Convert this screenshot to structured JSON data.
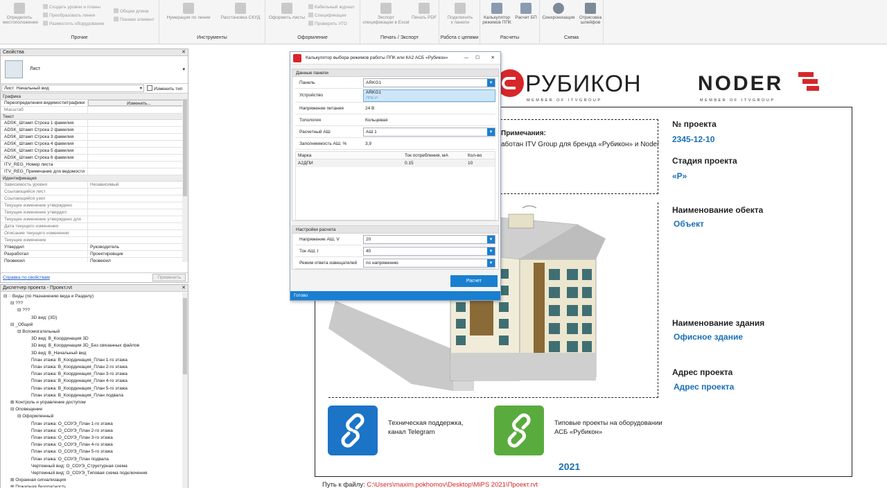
{
  "ribbon": {
    "groups": [
      {
        "label": "Прочие"
      },
      {
        "label": "Инструменты"
      },
      {
        "label": "Оформление"
      },
      {
        "label": "Печать / Экспорт"
      },
      {
        "label": "Работа с цепями"
      },
      {
        "label": "Расчеты"
      },
      {
        "label": "Схема"
      }
    ],
    "buttons": {
      "determine_location": "Определить\nместоположение",
      "create_levels": "Создать уровни и планы",
      "transform_lines": "Преобразовать линии",
      "place_equipment": "Разместить оборудование",
      "total_length": "Общая длина",
      "show_element": "Покажи элемент",
      "numbering": "Нумерация по линии",
      "skud": "Расстановка СКУД",
      "format_sheets": "Оформить листы",
      "cable_journal": "Кабельный журнал",
      "specification": "Спецификация",
      "check_ugo": "Проверить УГО",
      "export_spec": "Экспорт\nспецификации в Excel",
      "print_pdf": "Печать PDF",
      "connect_panels": "Подключить\nк панели",
      "calc_ppk": "Калькулятор\nрежимов ППК",
      "calc_bt": "Расчет БП",
      "sync": "Синхронизация",
      "draw_loops": "Отрисовка\nшлейфов"
    }
  },
  "properties": {
    "title": "Свойства",
    "type_name": "Лист",
    "instance": "Лист: Начальный вид",
    "edit_type": "Изменить тип",
    "sec_graphics": "Графика",
    "overrides_label": "Переопределения видимости/графики",
    "overrides_value": "Изменить...",
    "scale": "Масштаб",
    "sec_text": "Текст",
    "text_rows": [
      "ADSK_Штамп Строка 1 фамилия",
      "ADSK_Штамп Строка 2 фамилия",
      "ADSK_Штамп Строка 3 фамилия",
      "ADSK_Штамп Строка 4 фамилия",
      "ADSK_Штамп Строка 5 фамилия",
      "ADSK_Штамп Строка 6 фамилия",
      "ITV_REG_Номер листа",
      "ITV_REG_Примечание для ведомости"
    ],
    "sec_ident": "Идентификация",
    "ident_rows": [
      {
        "k": "Зависимость уровня",
        "v": "Независимый",
        "grey": true
      },
      {
        "k": "Ссылающийся лист",
        "v": "",
        "grey": true
      },
      {
        "k": "Ссылающийся узел",
        "v": "",
        "grey": true
      },
      {
        "k": "Текущее изменение утверждено",
        "v": "",
        "grey": true
      },
      {
        "k": "Текущее изменение утвердил",
        "v": "",
        "grey": true
      },
      {
        "k": "Текущее изменение утверждено для",
        "v": "",
        "grey": true
      },
      {
        "k": "Дата текущего изменения",
        "v": "",
        "grey": true
      },
      {
        "k": "Описание текущего изменения",
        "v": "",
        "grey": true
      },
      {
        "k": "Текущее изменение",
        "v": "",
        "grey": true
      },
      {
        "k": "Утвердил",
        "v": "Руководитель",
        "grey": false
      },
      {
        "k": "Разработал",
        "v": "Проектировщик",
        "grey": false
      },
      {
        "k": "Проверил",
        "v": "Проверил",
        "grey": false
      }
    ],
    "help_link": "Справка по свойствам",
    "apply": "Применить"
  },
  "browser": {
    "title": "Диспетчер проекта - Проект.rvt",
    "items": [
      {
        "t": "⊟ ◌ Виды (по Назначению вида и Разделу)",
        "l": 0
      },
      {
        "t": "⊟ ???",
        "l": 1
      },
      {
        "t": "⊟ ???",
        "l": 2
      },
      {
        "t": "3D вид: {3D}",
        "l": 4
      },
      {
        "t": "⊟ _Общий",
        "l": 1
      },
      {
        "t": "⊟ Вспомогательный",
        "l": 2
      },
      {
        "t": "3D вид: В_Координация 3D",
        "l": 4
      },
      {
        "t": "3D вид: В_Координация 3D_Без связанных файлов",
        "l": 4
      },
      {
        "t": "3D вид: В_Начальный вид",
        "l": 4
      },
      {
        "t": "План этажа: В_Координация_План 1-го этажа",
        "l": 4
      },
      {
        "t": "План этажа: В_Координация_План 2-го этажа",
        "l": 4
      },
      {
        "t": "План этажа: В_Координация_План 3-го этажа",
        "l": 4
      },
      {
        "t": "План этажа: В_Координация_План 4-го этажа",
        "l": 4
      },
      {
        "t": "План этажа: В_Координация_План 5-го этажа",
        "l": 4
      },
      {
        "t": "План этажа: В_Координация_План подвала",
        "l": 4
      },
      {
        "t": "⊞ Контроль и управление доступом",
        "l": 1
      },
      {
        "t": "⊟ Оповещение",
        "l": 1
      },
      {
        "t": "⊟ Оформленный",
        "l": 2
      },
      {
        "t": "План этажа: О_СОУЭ_План 1-го этажа",
        "l": 4
      },
      {
        "t": "План этажа: О_СОУЭ_План 2-го этажа",
        "l": 4
      },
      {
        "t": "План этажа: О_СОУЭ_План 3-го этажа",
        "l": 4
      },
      {
        "t": "План этажа: О_СОУЭ_План 4-го этажа",
        "l": 4
      },
      {
        "t": "План этажа: О_СОУЭ_План 5-го этажа",
        "l": 4
      },
      {
        "t": "План этажа: О_СОУЭ_План подвала",
        "l": 4
      },
      {
        "t": "Чертежный вид: О_СОУЭ_Структурная схема",
        "l": 4
      },
      {
        "t": "Чертежный вид: О_СОУЭ_Типовая схема подключения",
        "l": 4
      },
      {
        "t": "⊞ Охранная сигнализация",
        "l": 1
      },
      {
        "t": "⊞ Пожарная безопасность",
        "l": 1
      }
    ]
  },
  "sheet": {
    "logo_rubikon": "РУБИКОН",
    "logo_rubikon_sub": "MEMBER OF ITVGROUP",
    "logo_noder": "NODER",
    "logo_noder_sub": "MEMBER OF ITVGROUP",
    "note_title": "Примечания:",
    "note_text": "аботан ITV Group для бренда «Рубикон» и Noder",
    "project_no_label": "№ проекта",
    "project_no": "2345-12-10",
    "stage_label": "Стадия проекта",
    "stage": "«Р»",
    "object_label": "Наименование обекта",
    "object": "Объект",
    "building_label": "Наименование здания",
    "building": "Офисное здание",
    "address_label": "Адрес проекта",
    "address": "Адрес проекта",
    "support_text": "Техническая поддержка,  канал Telegram",
    "typical_text": "Типовые проекты на оборудовании АСБ «Рубикон»",
    "year": "2021",
    "path_label": "Путь к файлу:",
    "path": "C:\\Users\\maxim.pokhomov\\Desktop\\MiPS 2021\\Проект.rvt"
  },
  "dialog": {
    "title": "Калькулятор выбора режимов работы ППК или КА2 АСБ «Рубикон»",
    "sec_panel": "Данные панели",
    "panel_label": "Панель",
    "panel_value": "ARKG1",
    "device_label": "Устройство",
    "device_value": "ARKG1",
    "device_sub": "ППК-Р",
    "voltage_label": "Напряжение питания",
    "voltage_value": "24 В",
    "topology_label": "Топология",
    "topology_value": "Кольцевая",
    "loop_label": "Расчетный АШ",
    "loop_value": "АШ 1",
    "fill_label": "Заполняемость АШ, %",
    "fill_value": "3,9",
    "table_headers": [
      "Марка",
      "Ток потребления, мА",
      "Кол-во"
    ],
    "table_rows": [
      [
        "А2ДПИ",
        "0.15",
        "10"
      ]
    ],
    "sec_settings": "Настройки расчета",
    "voltage_ash_label": "Напряжение АШ, V",
    "voltage_ash_value": "20",
    "current_ash_label": "Ток АШ, I",
    "current_ash_value": "40",
    "mode_label": "Режим ответа извещателей",
    "mode_value": "по напряжению",
    "calc_button": "Расчет",
    "status": "Готово"
  },
  "colors": {
    "accent": "#1a7fd1",
    "brand_red": "#d7262a",
    "sheet_blue": "#1a6fb8",
    "telegram_blue": "#1b74c6",
    "typical_green": "#5aab3d"
  }
}
